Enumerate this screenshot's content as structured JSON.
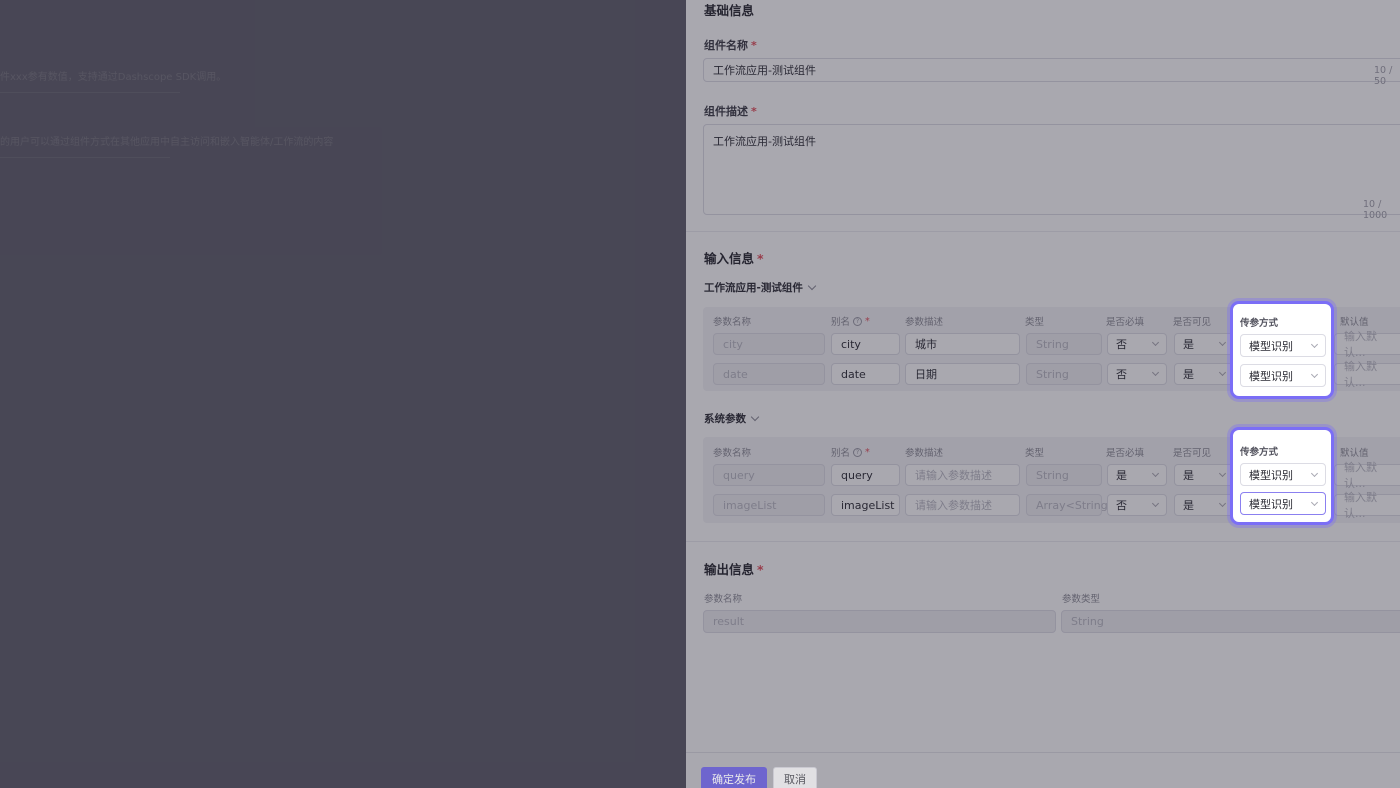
{
  "background": {
    "line1": "件xxx参有数值，支持通过Dashscope SDK调用。",
    "line2": "的用户可以通过组件方式在其他应用中自主访问和嵌入智能体/工作流的内容"
  },
  "basic": {
    "section_title": "基础信息",
    "name_label": "组件名称",
    "name_value": "工作流应用-测试组件",
    "name_counter": "10 / 50",
    "desc_label": "组件描述",
    "desc_value": "工作流应用-测试组件",
    "desc_counter": "10 / 1000"
  },
  "input": {
    "section_title": "输入信息",
    "group1_title": "工作流应用-测试组件",
    "group2_title": "系统参数",
    "columns": {
      "param_name": "参数名称",
      "alias": "别名",
      "param_desc": "参数描述",
      "type": "类型",
      "required": "是否必填",
      "visible": "是否可见",
      "pass_mode": "传参方式",
      "default": "默认值"
    },
    "group1_rows": [
      {
        "name": "city",
        "alias": "city",
        "desc": "城市",
        "type": "String",
        "required": "否",
        "visible": "是",
        "mode": "模型识别",
        "default": "输入默认..."
      },
      {
        "name": "date",
        "alias": "date",
        "desc": "日期",
        "type": "String",
        "required": "否",
        "visible": "是",
        "mode": "模型识别",
        "default": "输入默认..."
      }
    ],
    "group2_rows": [
      {
        "name": "query",
        "alias": "query",
        "desc": "请输入参数描述",
        "type": "String",
        "required": "是",
        "visible": "是",
        "mode": "模型识别",
        "default": "输入默认..."
      },
      {
        "name": "imageList",
        "alias": "imageList",
        "desc": "请输入参数描述",
        "type": "Array<String>",
        "required": "否",
        "visible": "是",
        "mode": "模型识别",
        "default": "输入默认..."
      }
    ]
  },
  "output": {
    "section_title": "输出信息",
    "name_label": "参数名称",
    "type_label": "参数类型",
    "name_value": "result",
    "type_value": "String"
  },
  "footer": {
    "publish_label": "确定发布",
    "cancel_label": "取消"
  },
  "colors": {
    "primary": "#5b4fd9",
    "highlight": "#7b6ef6",
    "required": "#e34d59"
  }
}
